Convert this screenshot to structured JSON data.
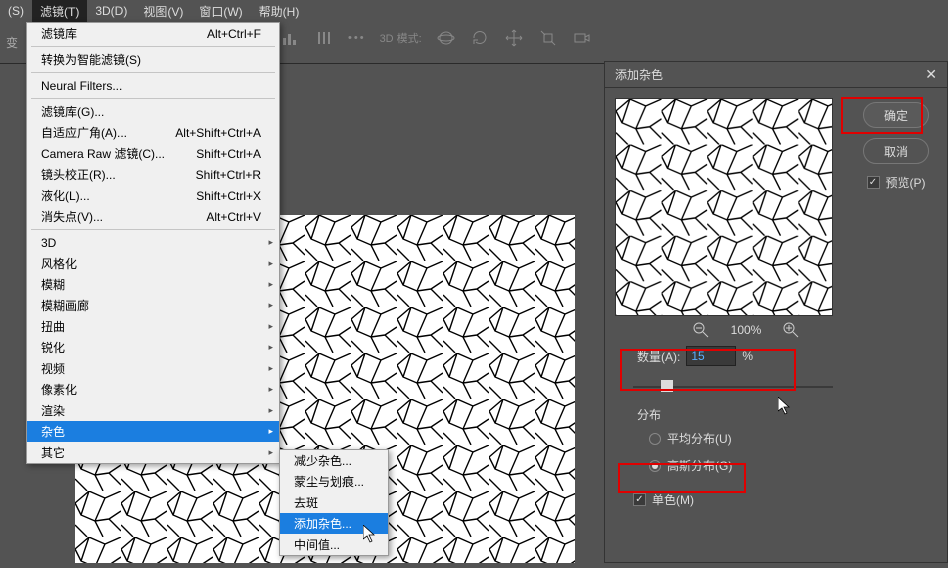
{
  "menubar": [
    {
      "label": "(S)",
      "active": false
    },
    {
      "label": "滤镜(T)",
      "active": true
    },
    {
      "label": "3D(D)",
      "active": false
    },
    {
      "label": "视图(V)",
      "active": false
    },
    {
      "label": "窗口(W)",
      "active": false
    },
    {
      "label": "帮助(H)",
      "active": false
    }
  ],
  "toolbar_prefix": "变",
  "toolbar_mode": "3D 模式:",
  "filter_menu": [
    {
      "label": "滤镜库",
      "short": "Alt+Ctrl+F",
      "sep_after": true
    },
    {
      "label": "转换为智能滤镜(S)",
      "sep_after": true
    },
    {
      "label": "Neural Filters...",
      "sep_after": true
    },
    {
      "label": "滤镜库(G)..."
    },
    {
      "label": "自适应广角(A)...",
      "short": "Alt+Shift+Ctrl+A"
    },
    {
      "label": "Camera Raw 滤镜(C)...",
      "short": "Shift+Ctrl+A"
    },
    {
      "label": "镜头校正(R)...",
      "short": "Shift+Ctrl+R"
    },
    {
      "label": "液化(L)...",
      "short": "Shift+Ctrl+X"
    },
    {
      "label": "消失点(V)...",
      "short": "Alt+Ctrl+V",
      "sep_after": true
    },
    {
      "label": "3D",
      "sub": true
    },
    {
      "label": "风格化",
      "sub": true
    },
    {
      "label": "模糊",
      "sub": true
    },
    {
      "label": "模糊画廊",
      "sub": true
    },
    {
      "label": "扭曲",
      "sub": true
    },
    {
      "label": "锐化",
      "sub": true
    },
    {
      "label": "视频",
      "sub": true
    },
    {
      "label": "像素化",
      "sub": true
    },
    {
      "label": "渲染",
      "sub": true
    },
    {
      "label": "杂色",
      "sub": true,
      "hl": true
    },
    {
      "label": "其它",
      "sub": true
    }
  ],
  "noise_submenu": [
    {
      "label": "减少杂色..."
    },
    {
      "label": "蒙尘与划痕..."
    },
    {
      "label": "去斑"
    },
    {
      "label": "添加杂色...",
      "hl": true
    },
    {
      "label": "中间值..."
    }
  ],
  "dialog": {
    "title": "添加杂色",
    "ok": "确定",
    "cancel": "取消",
    "preview_label": "预览(P)",
    "zoom": "100%",
    "amount_label": "数量(A):",
    "amount_value": "15",
    "amount_unit": "%",
    "dist_label": "分布",
    "dist_uniform": "平均分布(U)",
    "dist_gauss": "高斯分布(G)",
    "mono": "单色(M)"
  }
}
